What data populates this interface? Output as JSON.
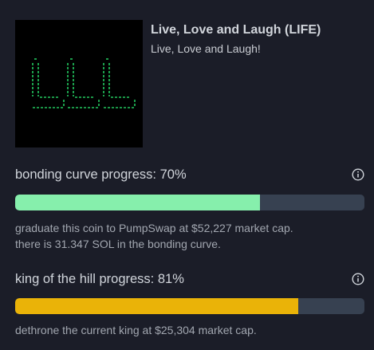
{
  "token": {
    "name": "Live, Love and Laugh (LIFE)",
    "description": "Live, Love and Laugh!",
    "image_icon": "ascii-art-lll-logo"
  },
  "bonding_curve": {
    "label": "bonding curve progress: 70%",
    "progress": 0.7,
    "fill_color": "#86efac",
    "track_color": "#374151",
    "note_line1": "graduate this coin to PumpSwap at $52,227 market cap.",
    "note_line2": "there is 31.347 SOL in the bonding curve.",
    "info_icon": "info-icon"
  },
  "king_of_the_hill": {
    "label": "king of the hill progress: 81%",
    "progress": 0.81,
    "fill_color": "#eab308",
    "track_color": "#374151",
    "note": "dethrone the current king at $25,304 market cap.",
    "info_icon": "info-icon"
  }
}
